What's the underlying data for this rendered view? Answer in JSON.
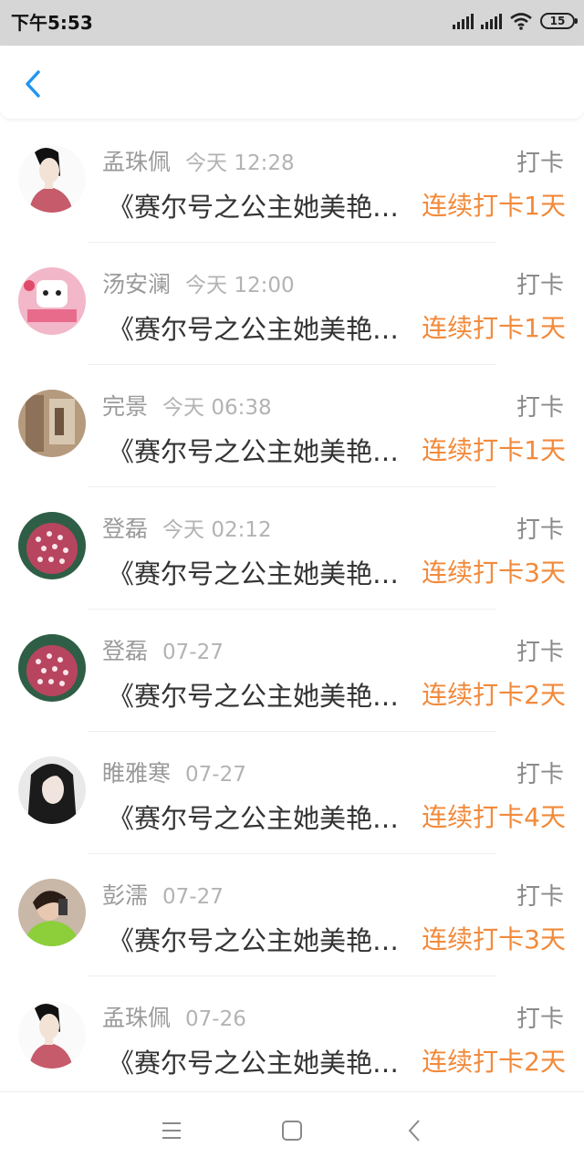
{
  "status_bar": {
    "time": "下午5:53",
    "battery": "15"
  },
  "header": {
    "back_icon": "chevron-left-icon"
  },
  "accent_color": "#f28a3b",
  "checkins": [
    {
      "name": "孟珠佩",
      "time": "今天 12:28",
      "tag": "打卡",
      "content": "《赛尔号之公主她美艳动人》",
      "streak": "连续打卡1天",
      "avatar": "woman-illustration-avatar"
    },
    {
      "name": "汤安澜",
      "time": "今天 12:00",
      "tag": "打卡",
      "content": "《赛尔号之公主她美艳动人》",
      "streak": "连续打卡1天",
      "avatar": "pink-cartoon-avatar"
    },
    {
      "name": "完景",
      "time": "今天 06:38",
      "tag": "打卡",
      "content": "《赛尔号之公主她美艳动人》",
      "streak": "连续打卡1天",
      "avatar": "brown-photo-avatar"
    },
    {
      "name": "登磊",
      "time": "今天 02:12",
      "tag": "打卡",
      "content": "《赛尔号之公主她美艳动人》",
      "streak": "连续打卡3天",
      "avatar": "flower-avatar"
    },
    {
      "name": "登磊",
      "time": "07-27",
      "tag": "打卡",
      "content": "《赛尔号之公主她美艳动人》",
      "streak": "连续打卡2天",
      "avatar": "flower-avatar"
    },
    {
      "name": "睢雅寒",
      "time": "07-27",
      "tag": "打卡",
      "content": "《赛尔号之公主她美艳动人》",
      "streak": "连续打卡4天",
      "avatar": "dark-hair-avatar"
    },
    {
      "name": "彭濡",
      "time": "07-27",
      "tag": "打卡",
      "content": "《赛尔号之公主她美艳动人》",
      "streak": "连续打卡3天",
      "avatar": "green-jacket-avatar"
    },
    {
      "name": "孟珠佩",
      "time": "07-26",
      "tag": "打卡",
      "content": "《赛尔号之公主她美艳动人》",
      "streak": "连续打卡2天",
      "avatar": "woman-illustration-avatar"
    }
  ],
  "bottom_nav": {
    "menu_icon": "menu-icon",
    "home_icon": "home-square-icon",
    "back_icon": "back-triangle-icon"
  }
}
